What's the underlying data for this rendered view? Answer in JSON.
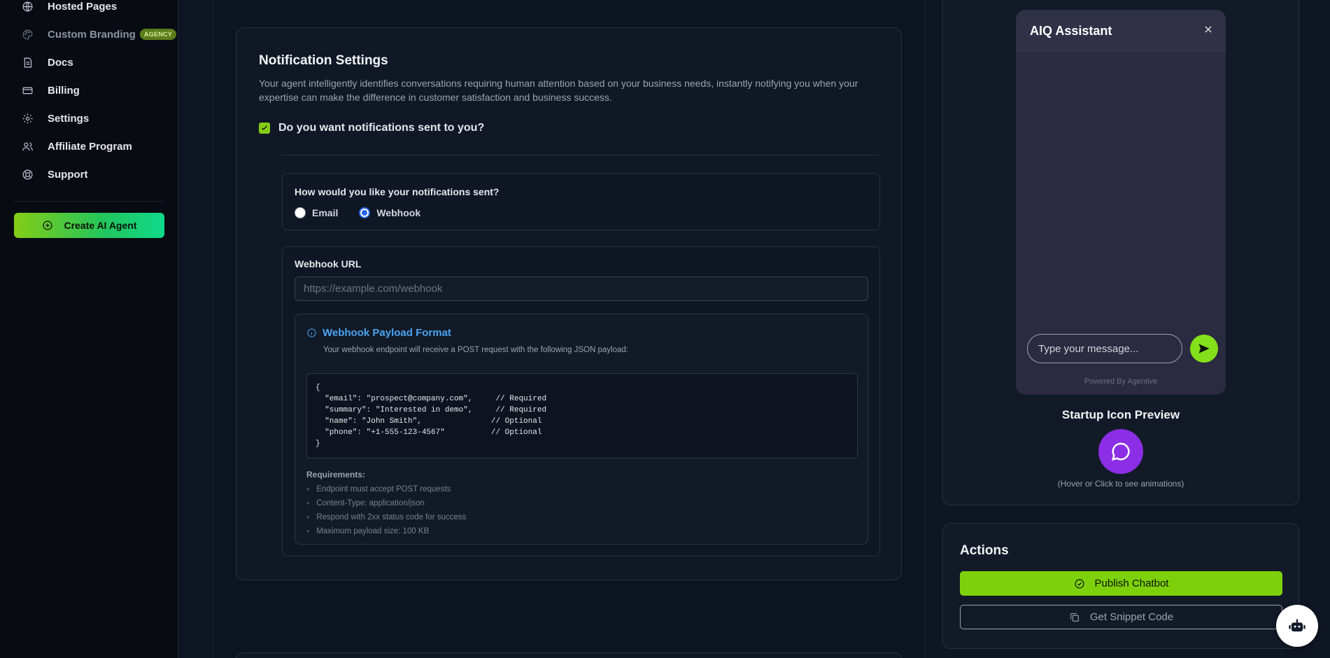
{
  "sidebar": {
    "items": [
      {
        "label": "Hosted Pages",
        "icon": "globe-icon"
      },
      {
        "label": "Custom Branding",
        "icon": "palette-icon",
        "badge": "AGENCY"
      },
      {
        "label": "Docs",
        "icon": "document-icon"
      },
      {
        "label": "Billing",
        "icon": "credit-card-icon"
      },
      {
        "label": "Settings",
        "icon": "gear-icon"
      },
      {
        "label": "Affiliate Program",
        "icon": "users-icon"
      },
      {
        "label": "Support",
        "icon": "lifebuoy-icon"
      }
    ],
    "create_button": "Create AI Agent"
  },
  "notifications": {
    "title": "Notification Settings",
    "description": "Your agent intelligently identifies conversations requiring human attention based on your business needs, instantly notifying you when your expertise can make the difference in customer satisfaction and business success.",
    "enable_label": "Do you want notifications sent to you?",
    "enabled": true,
    "method_question": "How would you like your notifications sent?",
    "methods": [
      {
        "label": "Email",
        "selected": false
      },
      {
        "label": "Webhook",
        "selected": true
      }
    ],
    "webhook": {
      "label": "Webhook URL",
      "value": "",
      "placeholder": "https://example.com/webhook",
      "payload_title": "Webhook Payload Format",
      "payload_subtitle": "Your webhook endpoint will receive a POST request with the following JSON payload:",
      "payload_code": "{\n  \"email\": \"prospect@company.com\",     // Required\n  \"summary\": \"Interested in demo\",     // Required\n  \"name\": \"John Smith\",               // Optional\n  \"phone\": \"+1-555-123-4567\"          // Optional\n}",
      "requirements_title": "Requirements:",
      "requirements": [
        "Endpoint must accept POST requests",
        "Content-Type: application/json",
        "Respond with 2xx status code for success",
        "Maximum payload size: 100 KB"
      ]
    }
  },
  "preview": {
    "chat_title": "AIQ Assistant",
    "input_placeholder": "Type your message...",
    "powered_by": "Powered By Agentive",
    "startup_title": "Startup Icon Preview",
    "startup_hint": "(Hover or Click to see animations)"
  },
  "actions": {
    "title": "Actions",
    "publish_label": "Publish Chatbot",
    "snippet_label": "Get Snippet Code"
  },
  "colors": {
    "accent": "#84cc16",
    "startup_icon": "#8b2ee6",
    "info": "#4aa3f0"
  }
}
